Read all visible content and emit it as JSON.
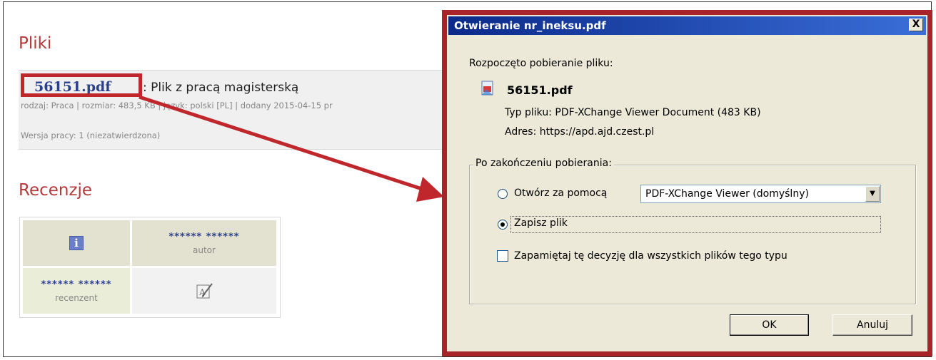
{
  "page": {
    "files_title": "Pliki",
    "file": {
      "link": "56151.pdf",
      "description": ": Plik z pracą magisterską",
      "meta": "rodzaj: Praca | rozmiar: 483,5 KB | język: polski [PL] | dodany 2015-04-15 pr",
      "version": "Wersja pracy: 1 (niezatwierdzona)"
    },
    "reviews_title": "Recenzje",
    "reviews": {
      "author_name": "****** ******",
      "author_role": "autor",
      "reviewer_name": "****** ******",
      "reviewer_role": "recenzent"
    }
  },
  "dialog": {
    "title": "Otwieranie nr_ineksu.pdf",
    "close_symbol": "X",
    "intro": "Rozpoczęto pobieranie pliku:",
    "filename": "56151.pdf",
    "type_line": "Typ pliku:  PDF-XChange Viewer Document (483 KB)",
    "address_line": "Adres:  https://apd.ajd.czest.pl",
    "group_label": "Po zakończeniu pobierania:",
    "open_with_label": "Otwórz za pomocą",
    "open_with_value": "PDF-XChange Viewer (domyślny)",
    "save_label": "Zapisz plik",
    "remember_label": "Zapamiętaj tę decyzję dla wszystkich plików tego typu",
    "ok_label": "OK",
    "cancel_label": "Anuluj",
    "selected_option": "save",
    "remember_checked": false
  },
  "colors": {
    "highlight": "#c0272d",
    "title_red": "#b33a3a",
    "link_blue": "#2b3f8f",
    "titlebar_start": "#0b2a8a",
    "titlebar_end": "#3a6ed8",
    "dialog_bg": "#ece9d8"
  },
  "icons": [
    "info-icon",
    "edit-review-icon",
    "pdf-file-icon",
    "close-icon",
    "dropdown-arrow-icon",
    "annotation-arrow"
  ]
}
